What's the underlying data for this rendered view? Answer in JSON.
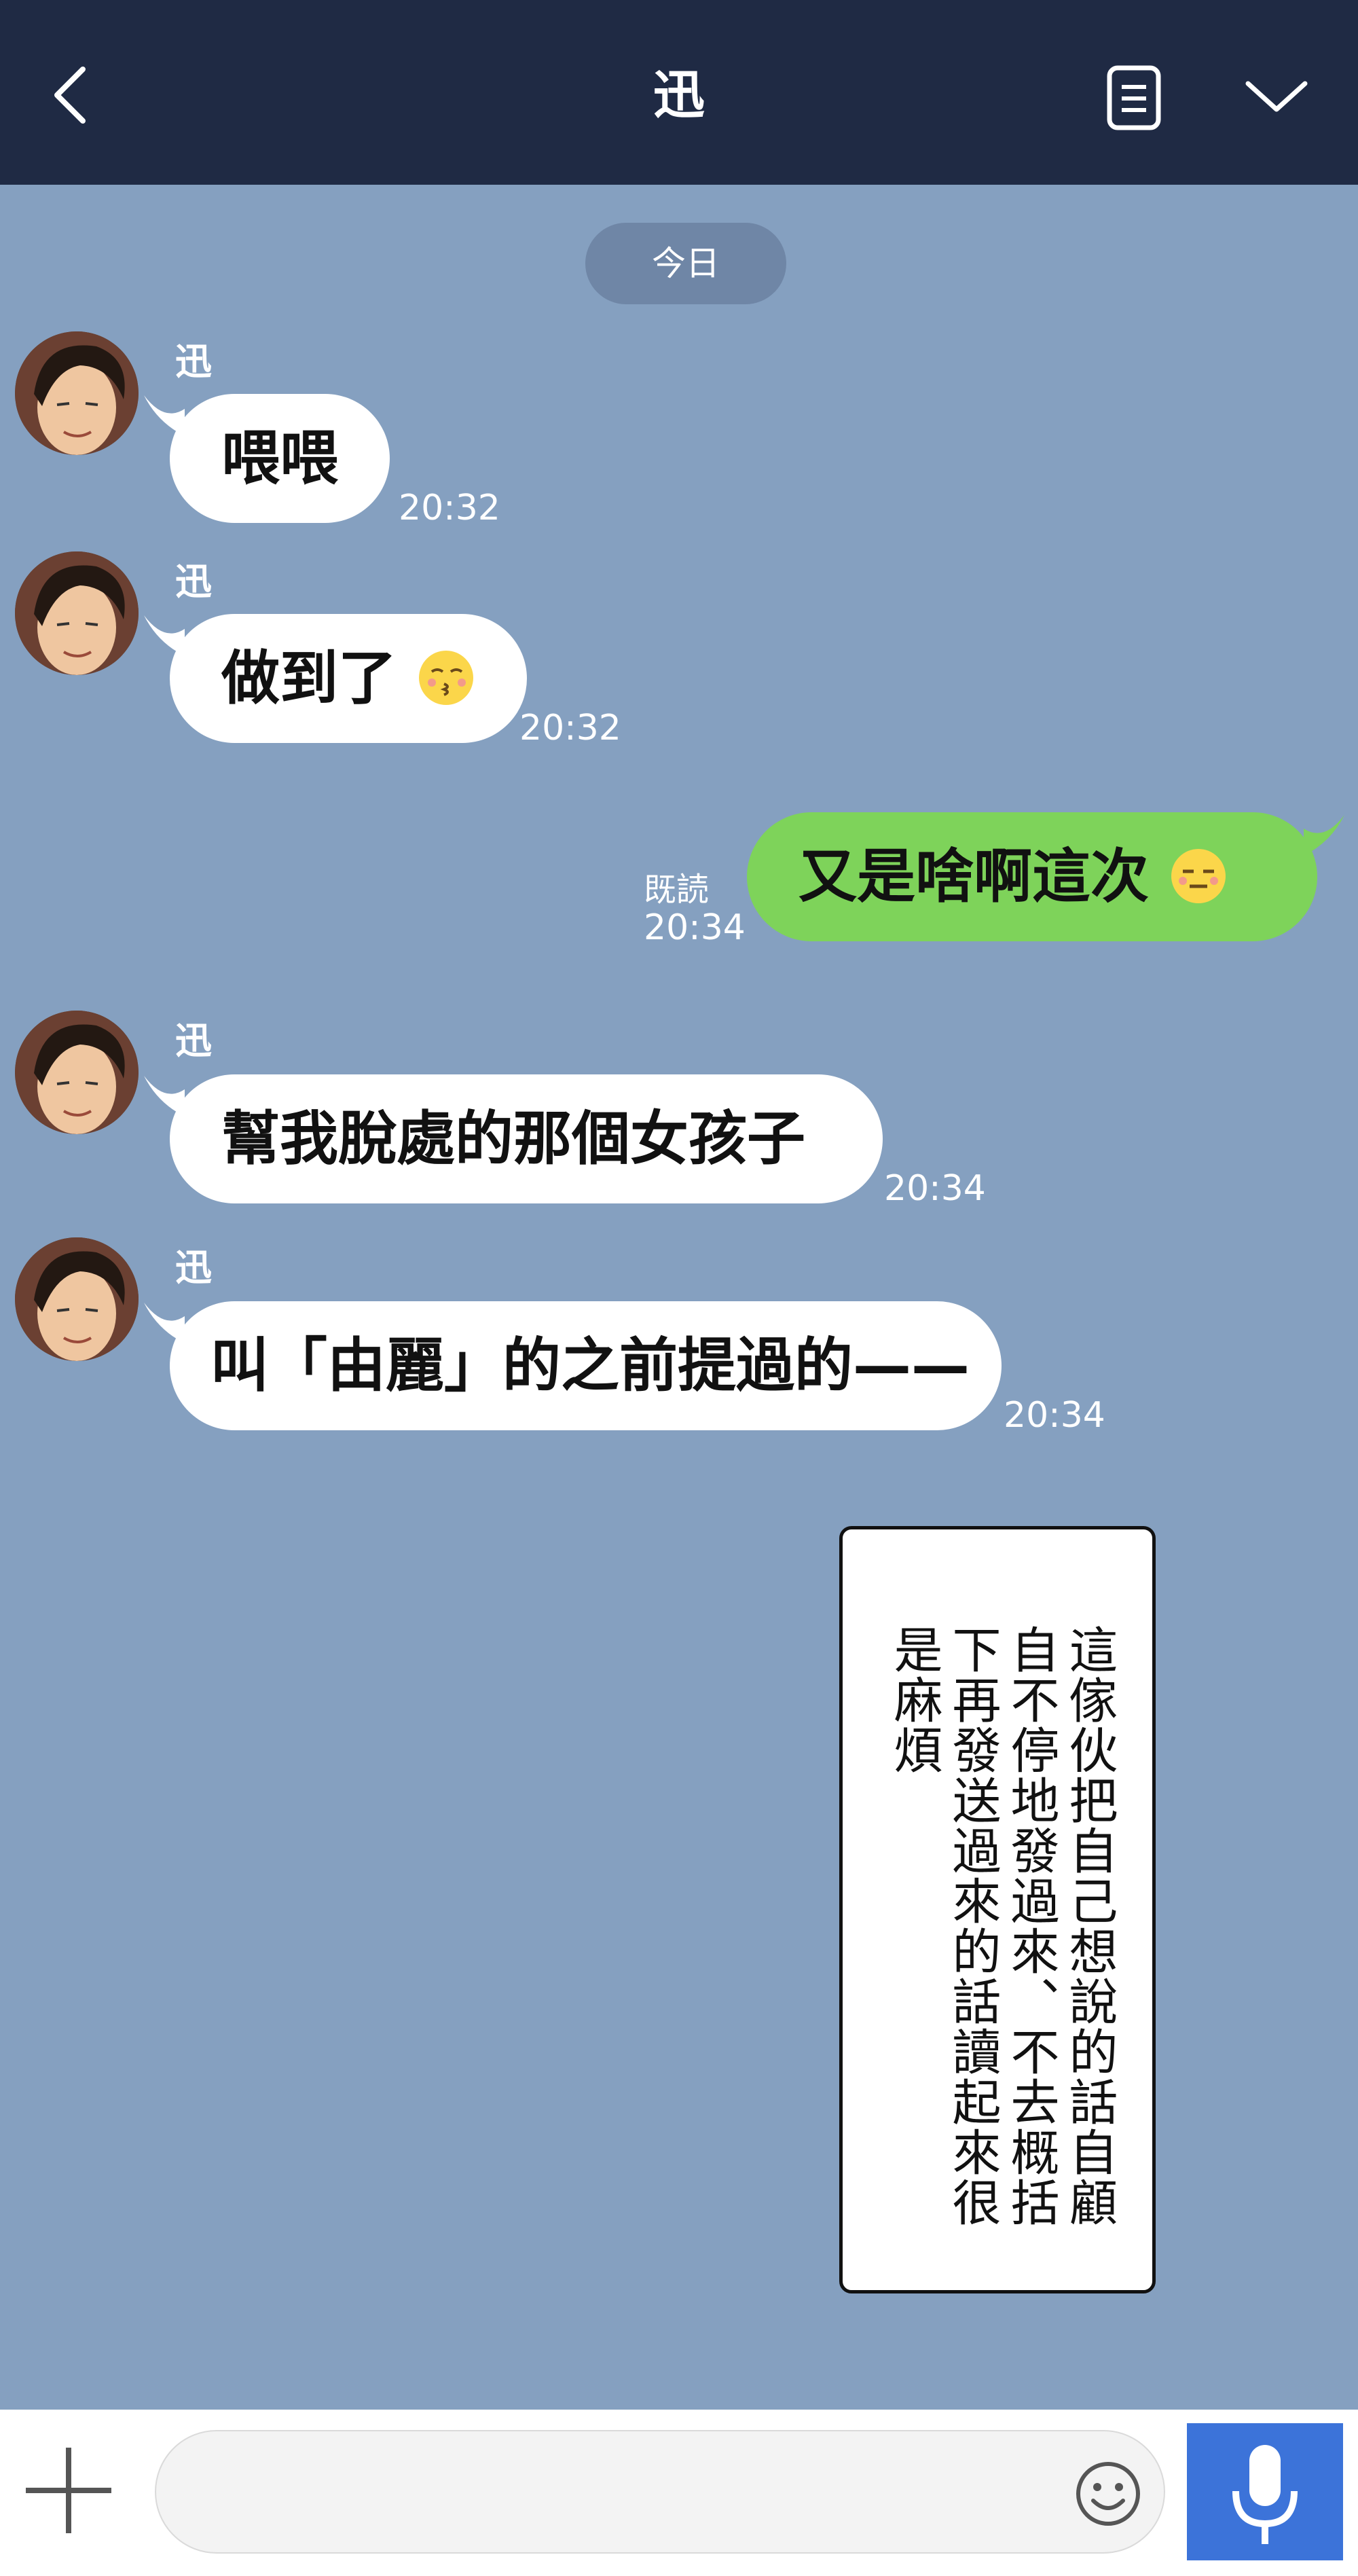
{
  "header": {
    "title": "迅"
  },
  "date_label": "今日",
  "messages": [
    {
      "sender": "迅",
      "text": "喂喂",
      "time": "20:32"
    },
    {
      "sender": "迅",
      "text": "做到了",
      "emoji": "kissing-face",
      "time": "20:32"
    },
    {
      "mine": true,
      "read": "既読",
      "text": "又是啥啊這次",
      "emoji": "expressionless-face",
      "time": "20:34"
    },
    {
      "sender": "迅",
      "text": "幫我脫處的那個女孩子",
      "time": "20:34"
    },
    {
      "sender": "迅",
      "text": "叫「由麗」的之前提過的——",
      "time": "20:34"
    }
  ],
  "caption": "這傢伙把自己想說的話自顧自不停地發過來、不去概括下再發送過來的話讀起來很是麻煩",
  "input": {
    "placeholder": ""
  },
  "colors": {
    "header": "#1f2a44",
    "chat_bg": "#85a0c0",
    "my_bubble": "#7ed35a",
    "send_accent": "#3c73d9"
  }
}
